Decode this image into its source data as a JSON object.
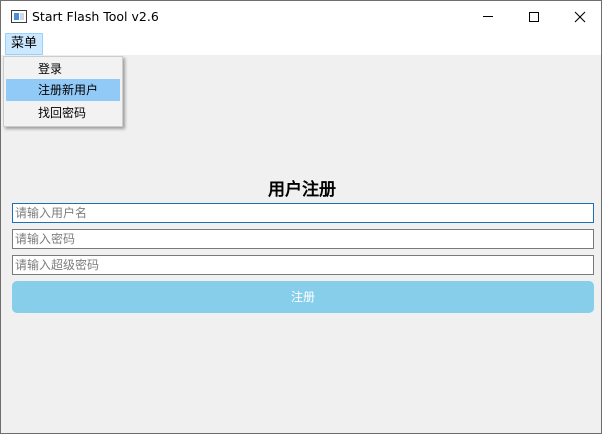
{
  "window": {
    "title": "Start Flash Tool v2.6",
    "controls": {
      "minimize": "minimize",
      "maximize": "maximize",
      "close": "✕"
    }
  },
  "menubar": {
    "menu_label": "菜单",
    "items": [
      {
        "label": "登录",
        "highlighted": false
      },
      {
        "label": "注册新用户",
        "highlighted": true
      },
      {
        "label": "找回密码",
        "highlighted": false
      }
    ]
  },
  "form": {
    "title": "用户注册",
    "username_placeholder": "请输入用户名",
    "password_placeholder": "请输入密码",
    "super_password_placeholder": "请输入超级密码",
    "submit_label": "注册"
  },
  "colors": {
    "submit_button": "#87ceeb",
    "menu_highlight": "#91c9f7",
    "focused_field_border": "#1e6fb8"
  }
}
